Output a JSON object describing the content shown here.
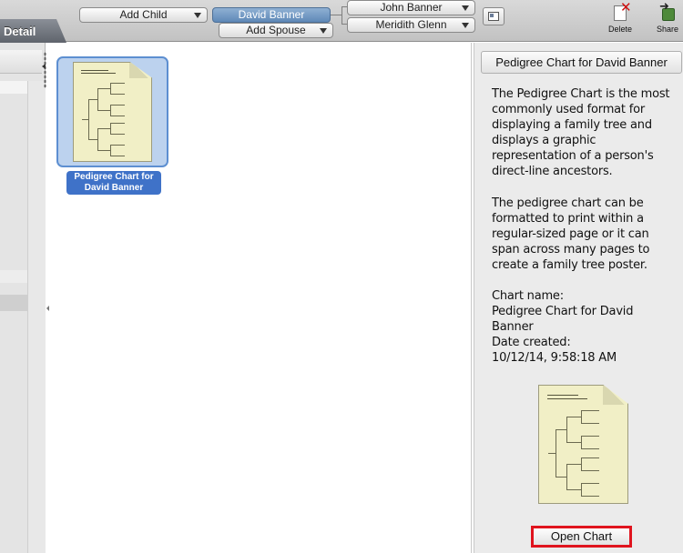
{
  "header": {
    "tab_label": "Detail"
  },
  "family_nav": {
    "add_child": "Add Child",
    "current_person": "David Banner",
    "add_spouse": "Add Spouse",
    "father": "John Banner",
    "mother": "Meridith Glenn"
  },
  "toolbar": {
    "delete_label": "Delete",
    "share_label": "Share"
  },
  "gallery": {
    "items": [
      {
        "caption": "Pedigree Chart for David Banner"
      }
    ]
  },
  "details": {
    "title": "Pedigree Chart for David Banner",
    "paragraph1": "The Pedigree Chart is the most commonly used format for displaying a family tree and displays a graphic representation of a person's direct-line ancestors.",
    "paragraph2": "The pedigree chart can be formatted to print within a regular-sized page or it can span across many pages to create a family tree poster.",
    "chart_name_label": "Chart name:",
    "chart_name_value": "Pedigree Chart for David Banner",
    "date_created_label": "Date created:",
    "date_created_value": "10/12/14, 9:58:18 AM",
    "open_button": "Open Chart"
  },
  "colors": {
    "selected_blue": "#3f72c8",
    "highlight_red": "#e0141e",
    "chart_paper": "#f1efc6"
  },
  "icons": {
    "delete": "delete-icon",
    "share": "share-icon",
    "view": "person-card-icon"
  }
}
